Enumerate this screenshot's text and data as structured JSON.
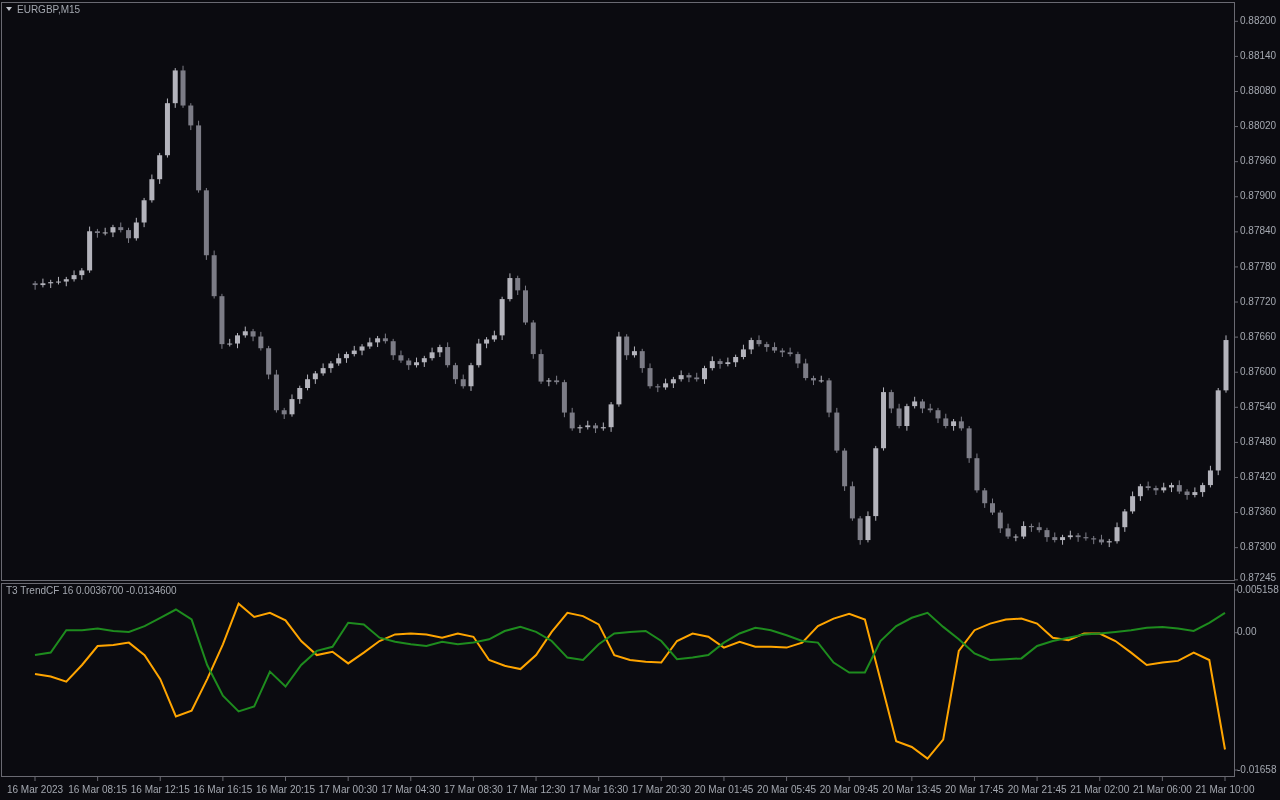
{
  "price_chart": {
    "chart_data": {
      "type": "candlestick",
      "title": "EURGBP,M15",
      "categories": [
        null,
        null,
        null,
        null,
        null,
        null,
        null,
        null,
        null,
        null,
        null,
        null,
        null,
        null,
        null,
        null,
        null,
        null,
        null,
        null,
        null,
        null,
        null,
        null,
        null,
        null,
        null,
        null,
        null,
        null,
        null,
        null,
        null,
        null,
        null,
        null,
        null,
        null,
        null,
        null,
        null,
        null,
        null,
        null,
        null,
        null,
        null,
        null,
        null,
        null,
        null,
        null,
        null,
        null,
        null,
        null,
        null,
        null,
        null,
        null,
        null,
        null,
        null,
        null,
        null,
        null,
        null,
        null,
        null,
        null,
        null,
        null,
        null,
        null,
        null,
        null,
        null,
        null,
        null,
        null,
        null,
        null,
        null,
        null,
        null,
        null,
        null,
        null,
        null,
        null,
        null,
        null,
        null,
        null,
        null,
        null,
        null,
        null,
        null,
        null,
        null,
        null,
        null,
        null,
        null,
        null,
        null,
        null,
        null,
        null,
        null,
        null,
        null,
        null,
        null,
        null,
        null,
        null,
        null,
        null,
        null,
        null,
        null,
        null,
        null,
        null,
        null,
        null,
        null,
        null,
        null,
        null,
        null,
        null,
        null,
        null,
        null,
        null,
        null,
        null,
        null,
        null,
        null,
        null,
        null,
        null,
        null,
        null,
        null,
        null,
        null,
        null,
        null,
        null
      ],
      "ohlc": [
        [
          0.87752,
          0.87756,
          0.87741,
          0.87749
        ],
        [
          0.87749,
          0.8776,
          0.87745,
          0.87752
        ],
        [
          0.87752,
          0.87758,
          0.87744,
          0.87754
        ],
        [
          0.87754,
          0.87763,
          0.8775,
          0.87755
        ],
        [
          0.87755,
          0.87763,
          0.87747,
          0.87759
        ],
        [
          0.87759,
          0.87774,
          0.87755,
          0.87766
        ],
        [
          0.87766,
          0.87778,
          0.87758,
          0.87774
        ],
        [
          0.87774,
          0.87849,
          0.8777,
          0.87841
        ],
        [
          0.87841,
          0.87845,
          0.8783,
          0.87838
        ],
        [
          0.87838,
          0.87847,
          0.87834,
          0.87839
        ],
        [
          0.87839,
          0.87852,
          0.87831,
          0.87848
        ],
        [
          0.87848,
          0.87856,
          0.87839,
          0.87843
        ],
        [
          0.87843,
          0.87847,
          0.87821,
          0.87829
        ],
        [
          0.87829,
          0.87864,
          0.87825,
          0.87856
        ],
        [
          0.87856,
          0.87898,
          0.87848,
          0.87894
        ],
        [
          0.87894,
          0.87938,
          0.8789,
          0.8793
        ],
        [
          0.8793,
          0.87975,
          0.87922,
          0.87971
        ],
        [
          0.87971,
          0.88068,
          0.87967,
          0.8806
        ],
        [
          0.8806,
          0.8812,
          0.88052,
          0.88116
        ],
        [
          0.88116,
          0.88124,
          0.88052,
          0.88056
        ],
        [
          0.88056,
          0.8806,
          0.88014,
          0.88022
        ],
        [
          0.88022,
          0.8803,
          0.87907,
          0.87911
        ],
        [
          0.87911,
          0.87915,
          0.87792,
          0.878
        ],
        [
          0.878,
          0.87808,
          0.87726,
          0.8773
        ],
        [
          0.8773,
          0.87734,
          0.8764,
          0.87648
        ],
        [
          0.87648,
          0.87657,
          0.87644,
          0.87649
        ],
        [
          0.87649,
          0.87667,
          0.87641,
          0.87663
        ],
        [
          0.87663,
          0.87678,
          0.87659,
          0.8767
        ],
        [
          0.8767,
          0.87674,
          0.87653,
          0.87661
        ],
        [
          0.87661,
          0.87669,
          0.87637,
          0.87641
        ],
        [
          0.87641,
          0.87645,
          0.87588,
          0.87596
        ],
        [
          0.87596,
          0.87604,
          0.87531,
          0.87535
        ],
        [
          0.87535,
          0.87539,
          0.8752,
          0.87528
        ],
        [
          0.87528,
          0.87562,
          0.87524,
          0.87554
        ],
        [
          0.87554,
          0.87577,
          0.87546,
          0.87573
        ],
        [
          0.87573,
          0.87596,
          0.87569,
          0.87588
        ],
        [
          0.87588,
          0.87602,
          0.8758,
          0.87598
        ],
        [
          0.87598,
          0.87615,
          0.87594,
          0.87607
        ],
        [
          0.87607,
          0.87619,
          0.87599,
          0.87615
        ],
        [
          0.87615,
          0.87632,
          0.87611,
          0.87624
        ],
        [
          0.87624,
          0.87635,
          0.87616,
          0.87631
        ],
        [
          0.87631,
          0.87645,
          0.87627,
          0.87637
        ],
        [
          0.87637,
          0.87648,
          0.87629,
          0.87644
        ],
        [
          0.87644,
          0.87659,
          0.8764,
          0.87651
        ],
        [
          0.87651,
          0.87662,
          0.87643,
          0.87658
        ],
        [
          0.87658,
          0.87666,
          0.87649,
          0.87653
        ],
        [
          0.87653,
          0.87657,
          0.87621,
          0.87629
        ],
        [
          0.87629,
          0.87637,
          0.87616,
          0.8762
        ],
        [
          0.8762,
          0.87624,
          0.87604,
          0.87612
        ],
        [
          0.87612,
          0.87625,
          0.87608,
          0.87617
        ],
        [
          0.87617,
          0.87628,
          0.87609,
          0.87624
        ],
        [
          0.87624,
          0.87642,
          0.8762,
          0.87634
        ],
        [
          0.87634,
          0.87647,
          0.87626,
          0.87643
        ],
        [
          0.87643,
          0.87651,
          0.87608,
          0.87612
        ],
        [
          0.87612,
          0.87616,
          0.8758,
          0.87588
        ],
        [
          0.87588,
          0.87596,
          0.87572,
          0.87576
        ],
        [
          0.87576,
          0.87616,
          0.87568,
          0.87612
        ],
        [
          0.87612,
          0.87657,
          0.87608,
          0.87649
        ],
        [
          0.87649,
          0.8766,
          0.87641,
          0.87656
        ],
        [
          0.87656,
          0.87671,
          0.87652,
          0.87663
        ],
        [
          0.87663,
          0.87729,
          0.87655,
          0.87725
        ],
        [
          0.87725,
          0.87769,
          0.87721,
          0.87761
        ],
        [
          0.87761,
          0.87765,
          0.87732,
          0.8774
        ],
        [
          0.8774,
          0.87748,
          0.87681,
          0.87685
        ],
        [
          0.87685,
          0.87689,
          0.87623,
          0.87631
        ],
        [
          0.87631,
          0.87639,
          0.8758,
          0.87584
        ],
        [
          0.87584,
          0.8759,
          0.87576,
          0.87586
        ],
        [
          0.87586,
          0.87594,
          0.87579,
          0.87583
        ],
        [
          0.87583,
          0.87587,
          0.87523,
          0.87531
        ],
        [
          0.87531,
          0.87539,
          0.875,
          0.87504
        ],
        [
          0.87504,
          0.8751,
          0.87496,
          0.87506
        ],
        [
          0.87506,
          0.87517,
          0.87502,
          0.87509
        ],
        [
          0.87509,
          0.87513,
          0.87496,
          0.87504
        ],
        [
          0.87504,
          0.87514,
          0.875,
          0.87506
        ],
        [
          0.87506,
          0.87549,
          0.87498,
          0.87545
        ],
        [
          0.87545,
          0.87669,
          0.87541,
          0.87661
        ],
        [
          0.87661,
          0.87665,
          0.87621,
          0.87629
        ],
        [
          0.87629,
          0.87644,
          0.87625,
          0.87636
        ],
        [
          0.87636,
          0.8764,
          0.87599,
          0.87607
        ],
        [
          0.87607,
          0.87615,
          0.87572,
          0.87576
        ],
        [
          0.87576,
          0.8758,
          0.87566,
          0.87574
        ],
        [
          0.87574,
          0.87589,
          0.8757,
          0.87581
        ],
        [
          0.87581,
          0.87592,
          0.87573,
          0.87588
        ],
        [
          0.87588,
          0.87603,
          0.87584,
          0.87595
        ],
        [
          0.87595,
          0.87599,
          0.87583,
          0.87591
        ],
        [
          0.87591,
          0.87599,
          0.87584,
          0.87588
        ],
        [
          0.87588,
          0.87611,
          0.8758,
          0.87607
        ],
        [
          0.87607,
          0.87627,
          0.87603,
          0.87619
        ],
        [
          0.87619,
          0.87623,
          0.87606,
          0.87614
        ],
        [
          0.87614,
          0.87625,
          0.8761,
          0.87617
        ],
        [
          0.87617,
          0.8763,
          0.87609,
          0.87626
        ],
        [
          0.87626,
          0.87647,
          0.87622,
          0.87639
        ],
        [
          0.87639,
          0.87659,
          0.87631,
          0.87655
        ],
        [
          0.87655,
          0.87663,
          0.87644,
          0.87648
        ],
        [
          0.87648,
          0.87652,
          0.87635,
          0.87643
        ],
        [
          0.87643,
          0.87651,
          0.87633,
          0.87637
        ],
        [
          0.87637,
          0.87641,
          0.87626,
          0.87634
        ],
        [
          0.87634,
          0.87642,
          0.87627,
          0.87631
        ],
        [
          0.87631,
          0.87635,
          0.87607,
          0.87615
        ],
        [
          0.87615,
          0.87623,
          0.87586,
          0.8759
        ],
        [
          0.8759,
          0.87594,
          0.87578,
          0.87586
        ],
        [
          0.87586,
          0.87594,
          0.87582,
          0.87586
        ],
        [
          0.87586,
          0.8759,
          0.87523,
          0.87531
        ],
        [
          0.87531,
          0.87539,
          0.87462,
          0.87466
        ],
        [
          0.87466,
          0.8747,
          0.87397,
          0.87405
        ],
        [
          0.87405,
          0.87413,
          0.87346,
          0.8735
        ],
        [
          0.8735,
          0.87354,
          0.87305,
          0.87313
        ],
        [
          0.87313,
          0.87362,
          0.87309,
          0.87354
        ],
        [
          0.87354,
          0.87474,
          0.87346,
          0.8747
        ],
        [
          0.8747,
          0.87574,
          0.87466,
          0.87566
        ],
        [
          0.87566,
          0.8757,
          0.8753,
          0.87538
        ],
        [
          0.87538,
          0.87546,
          0.87504,
          0.87508
        ],
        [
          0.87508,
          0.87546,
          0.875,
          0.87542
        ],
        [
          0.87542,
          0.87558,
          0.87538,
          0.8755
        ],
        [
          0.8755,
          0.87554,
          0.8753,
          0.87538
        ],
        [
          0.87538,
          0.87546,
          0.87531,
          0.87535
        ],
        [
          0.87535,
          0.87539,
          0.87513,
          0.87521
        ],
        [
          0.87521,
          0.87529,
          0.87504,
          0.87508
        ],
        [
          0.87508,
          0.8752,
          0.875,
          0.87516
        ],
        [
          0.87516,
          0.87524,
          0.875,
          0.87504
        ],
        [
          0.87504,
          0.87508,
          0.87445,
          0.87453
        ],
        [
          0.87453,
          0.87461,
          0.87394,
          0.87398
        ],
        [
          0.87398,
          0.87402,
          0.87368,
          0.87376
        ],
        [
          0.87376,
          0.87384,
          0.87356,
          0.8736
        ],
        [
          0.8736,
          0.87364,
          0.87325,
          0.87333
        ],
        [
          0.87333,
          0.87341,
          0.87315,
          0.87319
        ],
        [
          0.87319,
          0.87323,
          0.87311,
          0.87319
        ],
        [
          0.87319,
          0.87345,
          0.87315,
          0.87337
        ],
        [
          0.87337,
          0.87341,
          0.87327,
          0.87335
        ],
        [
          0.87335,
          0.87343,
          0.87326,
          0.8733
        ],
        [
          0.8733,
          0.87334,
          0.8731,
          0.87318
        ],
        [
          0.87318,
          0.87326,
          0.87309,
          0.87313
        ],
        [
          0.87313,
          0.87322,
          0.87305,
          0.87318
        ],
        [
          0.87318,
          0.87329,
          0.87314,
          0.87321
        ],
        [
          0.87321,
          0.87325,
          0.8731,
          0.87318
        ],
        [
          0.87318,
          0.87326,
          0.87312,
          0.87316
        ],
        [
          0.87316,
          0.8732,
          0.87306,
          0.87314
        ],
        [
          0.87314,
          0.87322,
          0.87305,
          0.87309
        ],
        [
          0.87309,
          0.87315,
          0.87301,
          0.87311
        ],
        [
          0.87311,
          0.87343,
          0.87307,
          0.87335
        ],
        [
          0.87335,
          0.87366,
          0.87327,
          0.87362
        ],
        [
          0.87362,
          0.87396,
          0.87358,
          0.87388
        ],
        [
          0.87388,
          0.87409,
          0.8738,
          0.87405
        ],
        [
          0.87405,
          0.87413,
          0.87398,
          0.87402
        ],
        [
          0.87402,
          0.87406,
          0.8739,
          0.87398
        ],
        [
          0.87398,
          0.87411,
          0.87394,
          0.87403
        ],
        [
          0.87403,
          0.87411,
          0.87395,
          0.87407
        ],
        [
          0.87407,
          0.87415,
          0.87392,
          0.87396
        ],
        [
          0.87396,
          0.874,
          0.87382,
          0.8739
        ],
        [
          0.8739,
          0.87403,
          0.87386,
          0.87395
        ],
        [
          0.87395,
          0.87411,
          0.87387,
          0.87407
        ],
        [
          0.87407,
          0.8744,
          0.87403,
          0.87432
        ],
        [
          0.87432,
          0.87573,
          0.87424,
          0.87569
        ],
        [
          0.87569,
          0.87663,
          0.87565,
          0.87655
        ]
      ],
      "ylim": [
        0.87243,
        0.88233
      ],
      "yticks": [
        {
          "value": 0.882,
          "label": "0.88200"
        },
        {
          "value": 0.8814,
          "label": "0.88140"
        },
        {
          "value": 0.8808,
          "label": "0.88080"
        },
        {
          "value": 0.8802,
          "label": "0.88020"
        },
        {
          "value": 0.8796,
          "label": "0.87960"
        },
        {
          "value": 0.879,
          "label": "0.87900"
        },
        {
          "value": 0.8784,
          "label": "0.87840"
        },
        {
          "value": 0.8778,
          "label": "0.87780"
        },
        {
          "value": 0.8772,
          "label": "0.87720"
        },
        {
          "value": 0.8766,
          "label": "0.87660"
        },
        {
          "value": 0.876,
          "label": "0.87600"
        },
        {
          "value": 0.8754,
          "label": "0.87540"
        },
        {
          "value": 0.8748,
          "label": "0.87480"
        },
        {
          "value": 0.8742,
          "label": "0.87420"
        },
        {
          "value": 0.8736,
          "label": "0.87360"
        },
        {
          "value": 0.873,
          "label": "0.87300"
        },
        {
          "value": 0.87245,
          "label": "0.87245"
        }
      ]
    }
  },
  "indicator_chart": {
    "chart_data": {
      "type": "line",
      "title": "T3 TrendCF 16 0.0036700 -0.0134600",
      "categories": [
        "16 Mar 2023",
        null,
        null,
        null,
        "16 Mar 08:15",
        null,
        null,
        null,
        "16 Mar 12:15",
        null,
        null,
        null,
        "16 Mar 16:15",
        null,
        null,
        null,
        "16 Mar 20:15",
        null,
        null,
        null,
        "17 Mar 00:30",
        null,
        null,
        null,
        "17 Mar 04:30",
        null,
        null,
        null,
        "17 Mar 08:30",
        null,
        null,
        null,
        "17 Mar 12:30",
        null,
        null,
        null,
        "17 Mar 16:30",
        null,
        null,
        null,
        "17 Mar 20:30",
        null,
        null,
        null,
        "20 Mar 01:45",
        null,
        null,
        null,
        "20 Mar 05:45",
        null,
        null,
        null,
        "20 Mar 09:45",
        null,
        null,
        null,
        "20 Mar 13:45",
        null,
        null,
        null,
        "20 Mar 17:45",
        null,
        null,
        null,
        "20 Mar 21:45",
        null,
        null,
        null,
        "21 Mar 02:00",
        null,
        null,
        null,
        "21 Mar 06:00",
        null,
        null,
        null,
        "21 Mar 10:00"
      ],
      "series": [
        {
          "color": "#ffa500",
          "values": [
            -0.005,
            -0.0053,
            -0.0059,
            -0.0039,
            -0.0016,
            -0.0015,
            -0.0012,
            -0.0027,
            -0.0056,
            -0.0101,
            -0.0094,
            -0.0056,
            -0.0014,
            0.0035,
            0.0019,
            0.0024,
            0.0015,
            -0.001,
            -0.0027,
            -0.0023,
            -0.0037,
            -0.0024,
            -0.001,
            -0.0002,
            -0.0001,
            -0.0002,
            -0.0006,
            -0.0001,
            -0.0005,
            -0.0033,
            -0.004,
            -0.0044,
            -0.0027,
            0.0001,
            0.0024,
            0.002,
            0.001,
            -0.0027,
            -0.0033,
            -0.0035,
            -0.0036,
            -0.001,
            -0.0001,
            -0.0005,
            -0.0018,
            -0.0011,
            -0.0017,
            -0.0017,
            -0.0018,
            -0.0012,
            0.0008,
            0.0017,
            0.0023,
            0.0016,
            -0.0057,
            -0.0131,
            -0.0138,
            -0.0152,
            -0.0129,
            -0.0022,
            0.0003,
            0.0011,
            0.0016,
            0.0017,
            0.0011,
            -0.0006,
            -0.0009,
            -0.0001,
            -0.0001,
            -0.001,
            -0.0024,
            -0.0039,
            -0.0036,
            -0.0034,
            -0.0024,
            -0.0033,
            -0.0141
          ]
        },
        {
          "color": "#1e8c1e",
          "values": [
            -0.0027,
            -0.0024,
            0.0003,
            0.0003,
            0.0005,
            0.0002,
            0.0001,
            0.0008,
            0.0018,
            0.0028,
            0.0016,
            -0.0039,
            -0.0076,
            -0.0095,
            -0.0089,
            -0.0047,
            -0.0065,
            -0.0039,
            -0.0022,
            -0.0017,
            0.0012,
            0.001,
            -0.0006,
            -0.0011,
            -0.0014,
            -0.0016,
            -0.0011,
            -0.0014,
            -0.0012,
            -0.0008,
            0.0002,
            0.0007,
            0.0001,
            -0.001,
            -0.003,
            -0.0033,
            -0.0014,
            -0.0001,
            0.0001,
            0.0002,
            -0.001,
            -0.0032,
            -0.003,
            -0.0027,
            -0.0012,
            -0.0001,
            0.0006,
            0.0003,
            -0.0003,
            -0.001,
            -0.0012,
            -0.0036,
            -0.0048,
            -0.0048,
            -0.001,
            0.0008,
            0.0018,
            0.0024,
            0.0007,
            -0.0008,
            -0.0025,
            -0.0033,
            -0.0032,
            -0.0031,
            -0.0016,
            -0.001,
            -0.0006,
            -0.0002,
            -0.0001,
            0.0001,
            0.0003,
            0.0006,
            0.0007,
            0.0005,
            0.0002,
            0.0012,
            0.0024
          ]
        }
      ],
      "ylim": [
        -0.0173,
        0.00588
      ],
      "yticks": [
        {
          "value": 0.005158,
          "label": "0.005158"
        },
        {
          "value": 0,
          "label": "0.00"
        },
        {
          "value": -0.01658,
          "label": "-0.01658"
        }
      ]
    }
  }
}
